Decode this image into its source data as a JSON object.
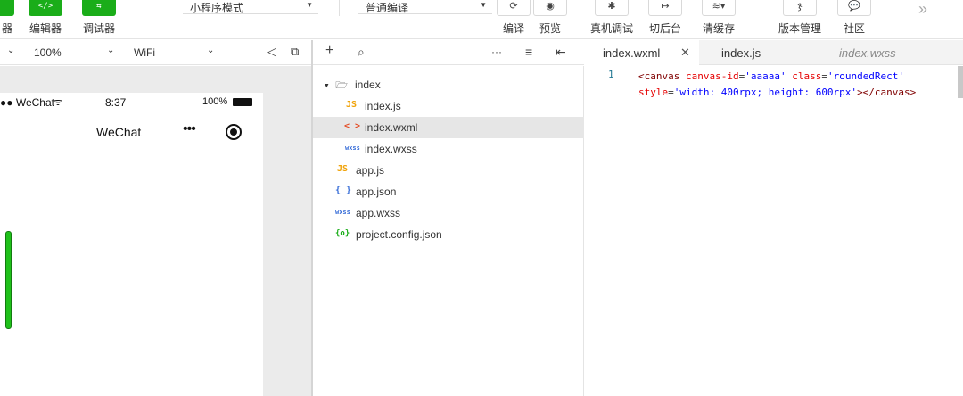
{
  "toolbar": {
    "simulator_label": "器",
    "editor_label": "编辑器",
    "debugger_label": "调试器",
    "mode_select": "小程序模式",
    "compile_select": "普通编译",
    "compile_label": "编译",
    "preview_label": "预览",
    "remote_debug_label": "真机调试",
    "background_label": "切后台",
    "clear_cache_label": "清缓存",
    "version_label": "版本管理",
    "community_label": "社区",
    "more_glyph": "»",
    "editor_icon_glyph": "</>",
    "debugger_icon_glyph": "⇆"
  },
  "simulator": {
    "zoom": "100%",
    "network": "WiFi",
    "status_bar": {
      "carrier": "●● WeChat",
      "time": "8:37",
      "battery": "100%"
    },
    "nav_title": "WeChat",
    "capsule_dots": "•••"
  },
  "tree": {
    "toolbar": {
      "add": "+",
      "search": "⌕",
      "more": "···",
      "collapse": "≡",
      "hide": "⇤"
    },
    "items": [
      {
        "name": "index",
        "icon": "folder-open",
        "glyph": "▾ 🗁"
      },
      {
        "name": "index.js",
        "icon": "js-file",
        "glyph": "JS"
      },
      {
        "name": "index.wxml",
        "icon": "wxml-file",
        "glyph": "< >"
      },
      {
        "name": "index.wxss",
        "icon": "wxss-file",
        "glyph": "wxss"
      },
      {
        "name": "app.js",
        "icon": "js-file",
        "glyph": "JS"
      },
      {
        "name": "app.json",
        "icon": "json-file",
        "glyph": "{ }"
      },
      {
        "name": "app.wxss",
        "icon": "wxss-file",
        "glyph": "wxss"
      },
      {
        "name": "project.config.json",
        "icon": "config-file",
        "glyph": "{o}"
      }
    ],
    "selected": "index.wxml"
  },
  "editor": {
    "tabs": [
      {
        "label": "index.wxml",
        "close": "✕"
      },
      {
        "label": "index.js"
      },
      {
        "label": "index.wxss"
      }
    ],
    "line_number": "1",
    "code": {
      "l1_open": "<canvas",
      "l1_attr1": " canvas-id",
      "l1_eq1": "=",
      "l1_val1": "'aaaaa'",
      "l1_attr2": " class",
      "l1_eq2": "=",
      "l1_val2": "'roundedRect'",
      "l2_attr3": "style",
      "l2_eq3": "=",
      "l2_val3": "'width: 400rpx; height: 600rpx'",
      "l2_close": "></canvas>"
    }
  },
  "colors": {
    "accent": "#1aad19",
    "selected_row": "#e6e6e6",
    "simulator_bg": "#ebebeb"
  }
}
